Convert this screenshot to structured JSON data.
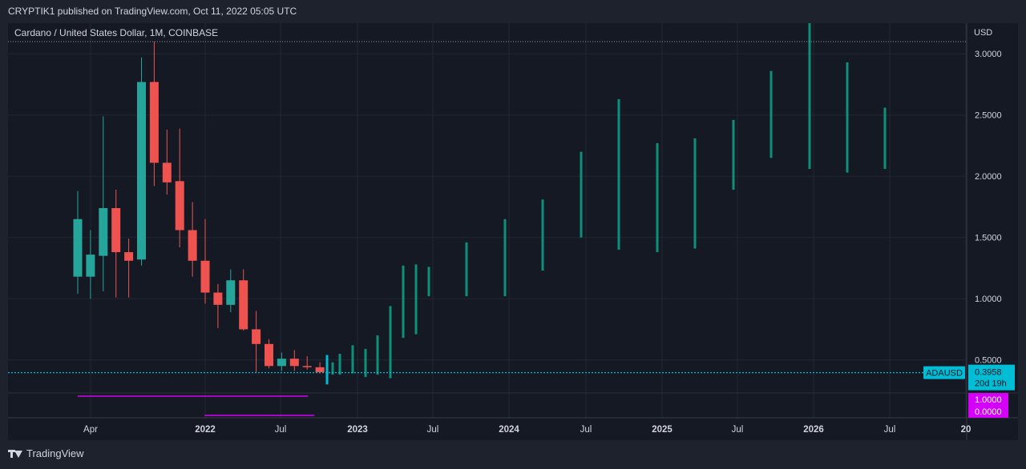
{
  "header": {
    "publisher": "CRYPTIK1 published on TradingView.com, Oct 11, 2022 05:05 UTC"
  },
  "footer": {
    "brand": "TradingView"
  },
  "colors": {
    "up": "#26a69a",
    "down": "#ef5350",
    "accent": "#00bcd4",
    "magenta": "#d500f9",
    "projection": "#0f8f7a"
  },
  "chart_data": {
    "type": "candlestick",
    "title": "Cardano / United States Dollar, 1M, COINBASE",
    "currency_label": "USD",
    "ylim": [
      0.23,
      3.25
    ],
    "y_ticks": [
      "0.5000",
      "1.0000",
      "1.5000",
      "2.0000",
      "2.5000",
      "3.0000"
    ],
    "x_ticks": [
      "Apr",
      "2022",
      "Jul",
      "2023",
      "Jul",
      "2024",
      "Jul",
      "2025",
      "Jul",
      "2026",
      "Jul",
      "20"
    ],
    "grid": true,
    "high_reference": 3.1,
    "current_price": {
      "symbol": "ADAUSD",
      "value": 0.3958,
      "price_label": "0.3958",
      "countdown": "20d 19h"
    },
    "candles": [
      {
        "o": 1.18,
        "h": 1.88,
        "l": 1.04,
        "c": 1.65
      },
      {
        "o": 1.18,
        "h": 1.56,
        "l": 1.0,
        "c": 1.36
      },
      {
        "o": 1.35,
        "h": 2.49,
        "l": 1.06,
        "c": 1.74
      },
      {
        "o": 1.74,
        "h": 1.89,
        "l": 1.01,
        "c": 1.38
      },
      {
        "o": 1.38,
        "h": 1.49,
        "l": 1.01,
        "c": 1.31
      },
      {
        "o": 1.32,
        "h": 2.97,
        "l": 1.27,
        "c": 2.77
      },
      {
        "o": 2.77,
        "h": 3.1,
        "l": 1.92,
        "c": 2.11
      },
      {
        "o": 2.11,
        "h": 2.38,
        "l": 1.85,
        "c": 1.95
      },
      {
        "o": 1.96,
        "h": 2.39,
        "l": 1.42,
        "c": 1.56
      },
      {
        "o": 1.56,
        "h": 1.79,
        "l": 1.18,
        "c": 1.31
      },
      {
        "o": 1.31,
        "h": 1.65,
        "l": 0.96,
        "c": 1.05
      },
      {
        "o": 1.05,
        "h": 1.12,
        "l": 0.76,
        "c": 0.95
      },
      {
        "o": 0.95,
        "h": 1.24,
        "l": 0.89,
        "c": 1.15
      },
      {
        "o": 1.15,
        "h": 1.24,
        "l": 0.74,
        "c": 0.75
      },
      {
        "o": 0.75,
        "h": 0.9,
        "l": 0.4,
        "c": 0.63
      },
      {
        "o": 0.63,
        "h": 0.67,
        "l": 0.43,
        "c": 0.45
      },
      {
        "o": 0.45,
        "h": 0.56,
        "l": 0.41,
        "c": 0.51
      },
      {
        "o": 0.51,
        "h": 0.58,
        "l": 0.41,
        "c": 0.45
      },
      {
        "o": 0.45,
        "h": 0.53,
        "l": 0.42,
        "c": 0.44
      },
      {
        "o": 0.44,
        "h": 0.48,
        "l": 0.39,
        "c": 0.4
      }
    ],
    "projection": [
      {
        "h": 0.54,
        "l": 0.3
      },
      {
        "h": 0.48,
        "l": 0.38
      },
      {
        "h": 0.55,
        "l": 0.38
      },
      {
        "h": 0.62,
        "l": 0.39
      },
      {
        "h": 0.59,
        "l": 0.36
      },
      {
        "h": 0.7,
        "l": 0.38
      },
      {
        "h": 0.94,
        "l": 0.35
      },
      {
        "h": 1.27,
        "l": 0.68
      },
      {
        "h": 1.28,
        "l": 0.71
      },
      {
        "h": 1.26,
        "l": 1.02
      },
      {
        "h": 1.46,
        "l": 1.02
      },
      {
        "h": 1.65,
        "l": 1.02
      },
      {
        "h": 1.81,
        "l": 1.23
      },
      {
        "h": 2.2,
        "l": 1.5
      },
      {
        "h": 2.63,
        "l": 1.4
      },
      {
        "h": 2.27,
        "l": 1.38
      },
      {
        "h": 2.31,
        "l": 1.41
      },
      {
        "h": 2.46,
        "l": 1.89
      },
      {
        "h": 2.86,
        "l": 2.15
      },
      {
        "h": 3.31,
        "l": 2.06
      },
      {
        "h": 2.93,
        "l": 2.03
      },
      {
        "h": 2.56,
        "l": 2.06
      }
    ],
    "indicator": {
      "labels": [
        "1.0000",
        "0.0000"
      ],
      "line1": {
        "x0": 0.0,
        "x1": 18.0
      },
      "line2": {
        "x0": 9.0,
        "x1": 18.5
      }
    }
  }
}
